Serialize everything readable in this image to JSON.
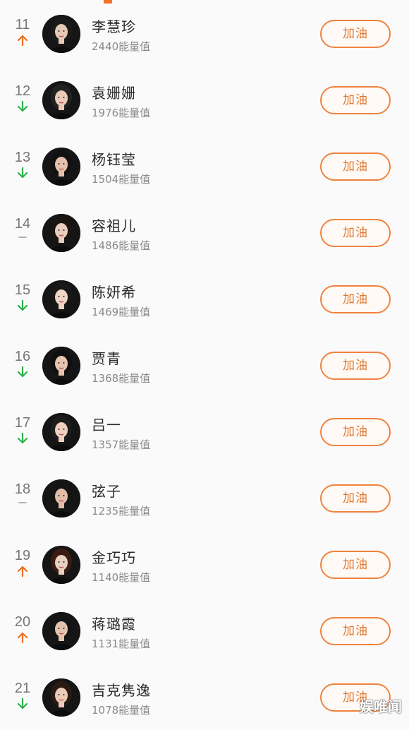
{
  "button_label": "加油",
  "colors": {
    "accent": "#f0823e",
    "up": "#f07020",
    "down": "#2bb24c",
    "flat": "#999999"
  },
  "rows": [
    {
      "rank": "11",
      "trend": "up",
      "name": "李慧珍",
      "score": "2440能量值"
    },
    {
      "rank": "12",
      "trend": "down",
      "name": "袁姗姗",
      "score": "1976能量值"
    },
    {
      "rank": "13",
      "trend": "down",
      "name": "杨钰莹",
      "score": "1504能量值"
    },
    {
      "rank": "14",
      "trend": "flat",
      "name": "容祖儿",
      "score": "1486能量值"
    },
    {
      "rank": "15",
      "trend": "down",
      "name": "陈妍希",
      "score": "1469能量值"
    },
    {
      "rank": "16",
      "trend": "down",
      "name": "贾青",
      "score": "1368能量值"
    },
    {
      "rank": "17",
      "trend": "down",
      "name": "吕一",
      "score": "1357能量值"
    },
    {
      "rank": "18",
      "trend": "flat",
      "name": "弦子",
      "score": "1235能量值"
    },
    {
      "rank": "19",
      "trend": "up",
      "name": "金巧巧",
      "score": "1140能量值"
    },
    {
      "rank": "20",
      "trend": "up",
      "name": "蒋璐霞",
      "score": "1131能量值"
    },
    {
      "rank": "21",
      "trend": "down",
      "name": "吉克隽逸",
      "score": "1078能量值"
    }
  ],
  "watermark": "娱唯闻"
}
